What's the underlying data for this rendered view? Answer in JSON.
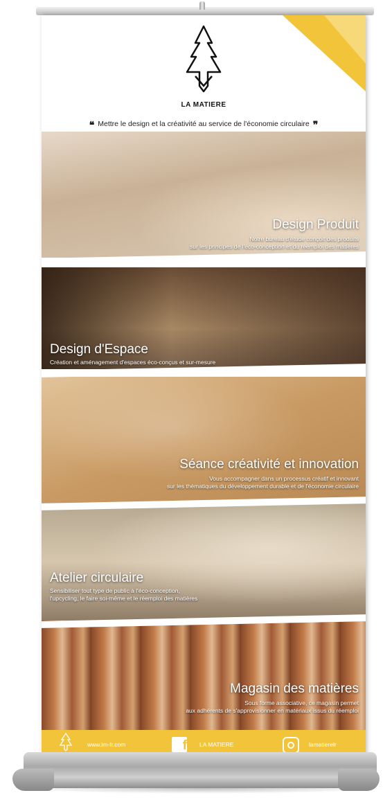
{
  "brand": {
    "name": "LA MATIERE"
  },
  "tagline": {
    "text": "Mettre le design et la créativité au service de l'économie circulaire",
    "open_quote": "❝",
    "close_quote": "❞"
  },
  "sections": [
    {
      "title": "Design Produit",
      "lines": [
        "Notre bureau d'étude conçoit des produits",
        "sur les principes de l'éco-conception et du réemploi des matières"
      ]
    },
    {
      "title": "Design d'Espace",
      "lines": [
        "Création et aménagement d'espaces éco-conçus et sur-mesure"
      ]
    },
    {
      "title": "Séance créativité et innovation",
      "lines": [
        "Vous accompagner dans un processus créatif et innovant",
        "sur les thématiques du développement durable et de l'économie circulaire"
      ]
    },
    {
      "title": "Atelier circulaire",
      "lines": [
        "Sensibiliser tout type de public à l'éco-conception,",
        "l'upcycling, le faire soi-même et le réemploi des matières"
      ]
    },
    {
      "title": "Magasin des matières",
      "lines": [
        "Sous forme associative, ce magasin permet",
        "aux adhérents de s'approvisionner en matériaux issus du réemploi"
      ]
    }
  ],
  "footer": {
    "website": "www.lm-fr.com",
    "facebook": "LA MATIERE",
    "instagram": "lamatierelr",
    "logo_small": "LA MATIERE"
  },
  "colors": {
    "accent": "#f2c43a"
  }
}
